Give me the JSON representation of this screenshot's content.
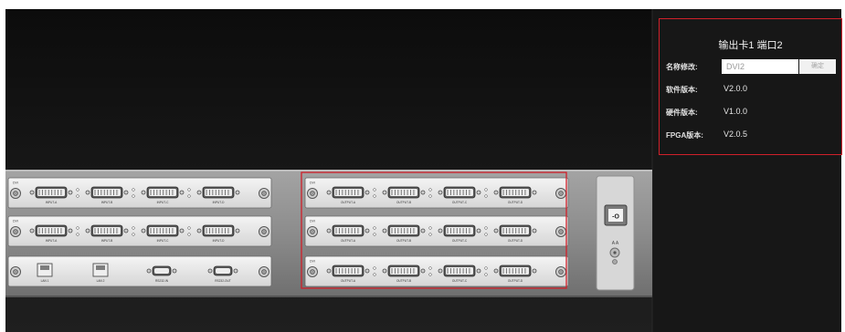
{
  "info_panel": {
    "title": "输出卡1 端口2",
    "rename_label": "名称修改:",
    "rename_value": "DVI2",
    "confirm_label": "确定",
    "software_label": "软件版本:",
    "software_value": "V2.0.0",
    "hardware_label": "硬件版本:",
    "hardware_value": "V1.0.0",
    "fpga_label": "FPGA版本:",
    "fpga_value": "V2.0.5"
  },
  "chassis": {
    "input_card_1": {
      "name": "DVI",
      "ports": [
        "INPUT-A",
        "INPUT-B",
        "INPUT-C",
        "INPUT-D"
      ]
    },
    "input_card_2": {
      "name": "DVI",
      "ports": [
        "INPUT-A",
        "INPUT-B",
        "INPUT-C",
        "INPUT-D"
      ]
    },
    "control_card": {
      "ports": [
        "LAN 1",
        "LAN 2",
        "RS232-IN",
        "RS232-OUT"
      ]
    },
    "output_card_1": {
      "name": "DVI",
      "ports": [
        "OUTPUT-A",
        "OUTPUT-B",
        "OUTPUT-C",
        "OUTPUT-D"
      ]
    },
    "output_card_2": {
      "name": "DVI",
      "ports": [
        "OUTPUT-A",
        "OUTPUT-B",
        "OUTPUT-C",
        "OUTPUT-D"
      ]
    },
    "output_card_3": {
      "name": "DVI",
      "ports": [
        "OUTPUT-A",
        "OUTPUT-B",
        "OUTPUT-C",
        "OUTPUT-D"
      ]
    },
    "power_switch_label": "-O",
    "power_module_text": "A  A"
  },
  "colors": {
    "background_top": "#101010",
    "background_bottom": "#1e1e1e",
    "side_panel": "#171717",
    "highlight": "#d0202a",
    "chassis": "#8a8a8a",
    "card": "#e6e6e6"
  }
}
